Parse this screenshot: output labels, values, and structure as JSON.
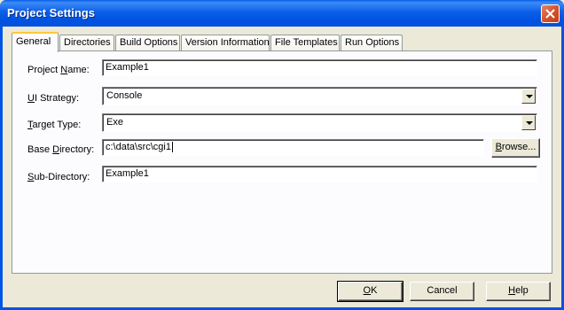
{
  "window": {
    "title": "Project Settings"
  },
  "tabs": [
    {
      "label": "General"
    },
    {
      "label": "Directories"
    },
    {
      "label": "Build Options"
    },
    {
      "label": "Version Information"
    },
    {
      "label": "File Templates"
    },
    {
      "label": "Run Options"
    }
  ],
  "form": {
    "project_name_label_pre": "Project ",
    "project_name_label_ul": "N",
    "project_name_label_post": "ame:",
    "project_name_value": "Example1",
    "ui_strategy_label_ul": "U",
    "ui_strategy_label_post": "I Strategy:",
    "ui_strategy_value": "Console",
    "target_type_label_ul": "T",
    "target_type_label_post": "arget Type:",
    "target_type_value": "Exe",
    "base_dir_label_pre": "Base ",
    "base_dir_label_ul": "D",
    "base_dir_label_post": "irectory:",
    "base_dir_value": "c:\\data\\src\\cgi1",
    "browse_label_ul": "B",
    "browse_label_post": "rowse...",
    "sub_dir_label_ul": "S",
    "sub_dir_label_post": "ub-Directory:",
    "sub_dir_value": "Example1"
  },
  "buttons": {
    "ok_ul": "O",
    "ok_post": "K",
    "cancel": "Cancel",
    "help_ul": "H",
    "help_post": "elp"
  }
}
